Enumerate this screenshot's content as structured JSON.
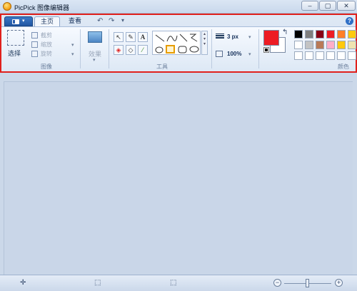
{
  "window": {
    "title": "PicPick 图像编辑器",
    "min": "–",
    "max": "▢",
    "close": "✕"
  },
  "tabs": [
    {
      "label": "主页"
    },
    {
      "label": "查看"
    }
  ],
  "quick_access": {
    "undo": "↶",
    "redo": "↷",
    "more": "▾"
  },
  "help": "?",
  "groups": {
    "image": {
      "label": "图像",
      "select": "选择",
      "crop": "截剪",
      "resize": "缩放",
      "rotate": "旋转"
    },
    "effect": {
      "label": "效果"
    },
    "tools": {
      "label": "工具",
      "text_glyph": "A"
    },
    "options": {
      "size": "3 px",
      "zoom": "100%"
    },
    "colors": {
      "label": "颜色",
      "primary": "#ed1c24",
      "secondary": "#ffffff",
      "swap_glyph": "↰",
      "palette_row1": [
        "#000000",
        "#7f7f7f",
        "#880015",
        "#ed1c24",
        "#ff7f27",
        "#ffc90e"
      ],
      "palette_row2": [
        "#ffffff",
        "#c3c3c3",
        "#b97a57",
        "#ffaec9",
        "#ffc90e",
        "#efe4b0"
      ],
      "palette_row3": [
        "#ffffff",
        "#ffffff",
        "#ffffff",
        "#ffffff",
        "#ffffff",
        "#ffffff"
      ]
    }
  },
  "statusbar": {
    "cursor_glyph": "✛",
    "selection_glyph": "⬚",
    "image_size_glyph": "⬚",
    "zoom_out": "−",
    "zoom_in": "+",
    "zoom_level": 0.5
  }
}
